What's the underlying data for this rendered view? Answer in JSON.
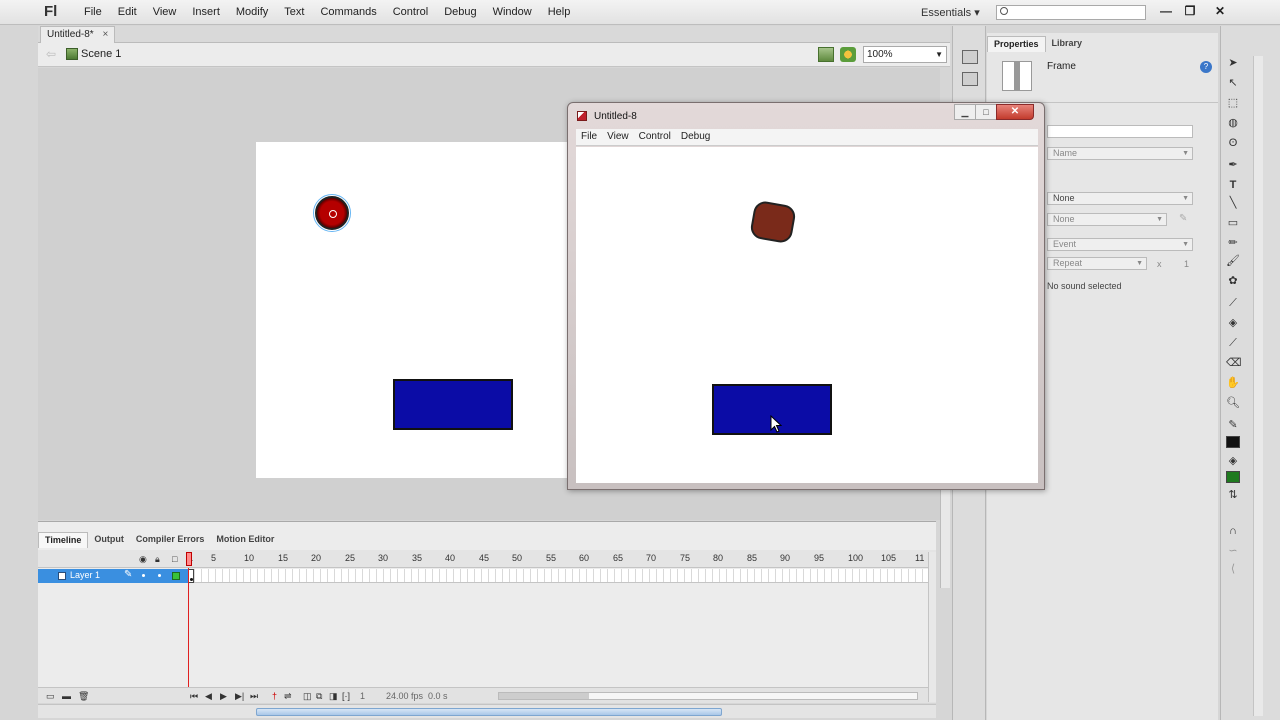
{
  "app": {
    "logo": "Fl",
    "menus": [
      "File",
      "Edit",
      "View",
      "Insert",
      "Modify",
      "Text",
      "Commands",
      "Control",
      "Debug",
      "Window",
      "Help"
    ],
    "workspace": "Essentials",
    "window_controls": [
      "—",
      "❐",
      "✕"
    ]
  },
  "document": {
    "tab_title": "Untitled-8*",
    "tab_close": "×",
    "scene": "Scene 1",
    "zoom": "100%"
  },
  "stage": {
    "ball_color": "#b50000",
    "paddle_color": "#0b0ca6"
  },
  "timeline": {
    "tabs": [
      "Timeline",
      "Output",
      "Compiler Errors",
      "Motion Editor"
    ],
    "layer_name": "Layer 1",
    "ruler_ticks": [
      "1",
      "5",
      "10",
      "15",
      "20",
      "25",
      "30",
      "35",
      "40",
      "45",
      "50",
      "55",
      "60",
      "65",
      "70",
      "75",
      "80",
      "85",
      "90",
      "95",
      "100",
      "105",
      "11"
    ],
    "current_frame": "1",
    "fps": "24.00 fps",
    "time": "0.0 s"
  },
  "properties": {
    "tabs": [
      "Properties",
      "Library"
    ],
    "selection_type": "Frame",
    "name_placeholder": "Name",
    "sound_name": "None",
    "effect": "None",
    "sync": "Event",
    "repeat": "Repeat",
    "repeat_x": "x",
    "repeat_count": "1",
    "no_sound": "No sound selected"
  },
  "player": {
    "title": "Untitled-8",
    "menus": [
      "File",
      "View",
      "Control",
      "Debug"
    ],
    "close": "✕",
    "ball_color": "#7a2a1a",
    "paddle_color": "#0b0ca6"
  }
}
